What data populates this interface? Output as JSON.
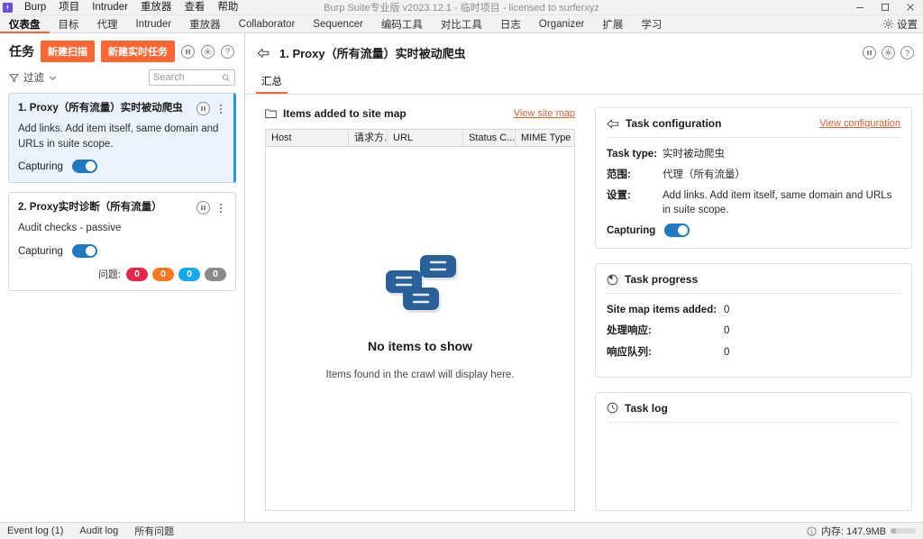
{
  "window": {
    "title": "Burp Suite专业版  v2023.12.1 - 临时项目 - licensed to surferxyz",
    "minimize": "—",
    "maximize": "▢",
    "close": "✕"
  },
  "menubar": {
    "app_name": "Burp",
    "items": [
      "项目",
      "Intruder",
      "重放器",
      "查看",
      "帮助"
    ]
  },
  "tabs": {
    "items": [
      {
        "label": "仪表盘",
        "active": true
      },
      {
        "label": "目标",
        "active": false
      },
      {
        "label": "代理",
        "active": false
      },
      {
        "label": "Intruder",
        "active": false
      },
      {
        "label": "重放器",
        "active": false
      },
      {
        "label": "Collaborator",
        "active": false
      },
      {
        "label": "Sequencer",
        "active": false
      },
      {
        "label": "编码工具",
        "active": false
      },
      {
        "label": "对比工具",
        "active": false
      },
      {
        "label": "日志",
        "active": false
      },
      {
        "label": "Organizer",
        "active": false
      },
      {
        "label": "扩展",
        "active": false
      },
      {
        "label": "学习",
        "active": false
      }
    ],
    "settings_label": "设置"
  },
  "tasks_panel": {
    "title": "任务",
    "new_scan_label": "新建扫描",
    "new_live_task_label": "新建实时任务",
    "pause_icon": "pause-icon",
    "settings_icon": "gear-icon",
    "help_icon": "help-icon",
    "filter_label": "过滤",
    "search_placeholder": "Search",
    "search_value": "",
    "cards": [
      {
        "title": "1. Proxy（所有流量）实时被动爬虫",
        "description": "Add links. Add item itself, same domain and URLs in suite scope.",
        "capturing_label": "Capturing",
        "capturing_on": true,
        "selected": true,
        "issues": null
      },
      {
        "title": "2. Proxy实时诊断（所有流量）",
        "description": "Audit checks - passive",
        "capturing_label": "Capturing",
        "capturing_on": true,
        "selected": false,
        "issues": {
          "label": "问题:",
          "counts": [
            {
              "value": "0",
              "color": "#e8274b"
            },
            {
              "value": "0",
              "color": "#fa7921"
            },
            {
              "value": "0",
              "color": "#11a8f0"
            },
            {
              "value": "0",
              "color": "#8a8a8a"
            }
          ]
        }
      }
    ]
  },
  "detail": {
    "title": "1. Proxy（所有流量）实时被动爬虫",
    "back_icon": "back-arrow-icon",
    "pause_icon": "pause-icon",
    "settings_icon": "gear-icon",
    "help_icon": "help-icon",
    "tabs": [
      {
        "label": "汇总",
        "active": true
      }
    ],
    "sitemap": {
      "title": "Items added to site map",
      "folder_icon": "folder-icon",
      "view_link": "View site map",
      "columns": [
        "Host",
        "请求方...",
        "URL",
        "Status C...",
        "MIME Type"
      ],
      "rows": [],
      "empty_title": "No items to show",
      "empty_sub": "Items found in the crawl will display here."
    },
    "configuration": {
      "title": "Task configuration",
      "icon": "crawl-icon",
      "view_link": "View configuration",
      "fields": [
        {
          "key": "Task type:",
          "value": "实时被动爬虫"
        },
        {
          "key": "范围:",
          "value": "代理（所有流量）"
        },
        {
          "key": "设置:",
          "value": "Add links. Add item itself, same domain and URLs in suite scope."
        }
      ],
      "capturing_label": "Capturing",
      "capturing_on": true
    },
    "progress": {
      "title": "Task progress",
      "icon": "progress-clock-icon",
      "rows": [
        {
          "key": "Site map items added:",
          "value": "0"
        },
        {
          "key": "处理响应:",
          "value": "0"
        },
        {
          "key": "响应队列:",
          "value": "0"
        }
      ]
    },
    "log": {
      "title": "Task log",
      "icon": "clock-icon",
      "entries": []
    }
  },
  "statusbar": {
    "event_log": "Event log (1)",
    "audit_log": "Audit log",
    "all_issues": "所有问题",
    "memory_icon": "info-icon",
    "memory": "内存: 147.9MB"
  }
}
